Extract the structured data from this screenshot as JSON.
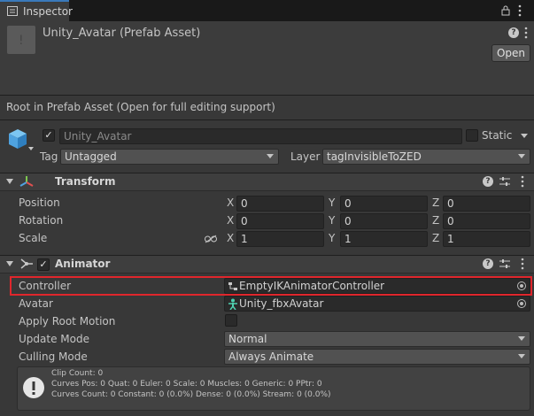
{
  "tab": {
    "label": "Inspector"
  },
  "asset": {
    "title": "Unity_Avatar (Prefab Asset)",
    "open_label": "Open"
  },
  "notice": "Root in Prefab Asset (Open for full editing support)",
  "gameobject": {
    "name": "Unity_Avatar",
    "static_label": "Static",
    "tag_label": "Tag",
    "tag_value": "Untagged",
    "layer_label": "Layer",
    "layer_value": "tagInvisibleToZED"
  },
  "transform": {
    "title": "Transform",
    "rows": [
      {
        "label": "Position",
        "x": "0",
        "y": "0",
        "z": "0"
      },
      {
        "label": "Rotation",
        "x": "0",
        "y": "0",
        "z": "0"
      },
      {
        "label": "Scale",
        "x": "1",
        "y": "1",
        "z": "1"
      }
    ],
    "axis_x": "X",
    "axis_y": "Y",
    "axis_z": "Z"
  },
  "animator": {
    "title": "Animator",
    "controller_label": "Controller",
    "controller_value": "EmptyIKAnimatorController",
    "avatar_label": "Avatar",
    "avatar_value": "Unity_fbxAvatar",
    "root_motion_label": "Apply Root Motion",
    "update_mode_label": "Update Mode",
    "update_mode_value": "Normal",
    "culling_mode_label": "Culling Mode",
    "culling_mode_value": "Always Animate",
    "info_lines": [
      "Clip Count: 0",
      "Curves Pos: 0 Quat: 0 Euler: 0 Scale: 0 Muscles: 0 Generic: 0 PPtr: 0",
      "Curves Count: 0 Constant: 0 (0.0%) Dense: 0 (0.0%) Stream: 0 (0.0%)"
    ]
  },
  "colors": {
    "highlight": "#e0262c",
    "tab_accent": "#3a79bb",
    "cube_icon": "#4fa3e0"
  }
}
